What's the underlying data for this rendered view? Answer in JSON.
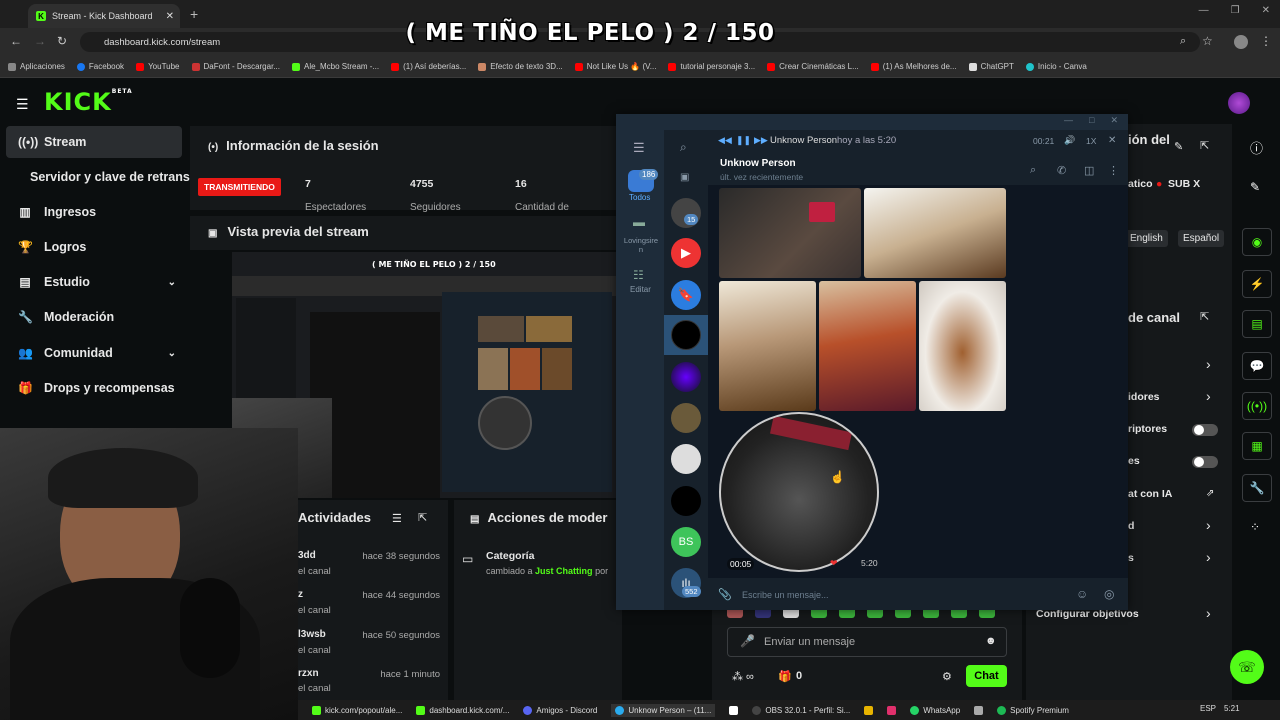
{
  "overlay_title": "( ME TIÑO EL PELO ) 2 / 150",
  "browser": {
    "tab_title": "Stream - Kick Dashboard",
    "url": "dashboard.kick.com/stream",
    "bookmarks": [
      "Aplicaciones",
      "Facebook",
      "YouTube",
      "DaFont - Descargar...",
      "Ale_Mcbo Stream -...",
      "(1) Así deberías...",
      "Efecto de texto 3D...",
      "Not Like Us 🔥 (V...",
      "tutorial personaje 3...",
      "Crear Cinemáticas L...",
      "(1) As Melhores de...",
      "ChatGPT",
      "Inicio - Canva"
    ]
  },
  "kick": {
    "logo": "KICK",
    "logo_sup": "BETA",
    "sidebar": [
      {
        "label": "Stream",
        "icon": "broadcast-icon"
      },
      {
        "label": "Servidor y clave de retransm",
        "icon": ""
      },
      {
        "label": "Ingresos",
        "icon": "chart-icon"
      },
      {
        "label": "Logros",
        "icon": "trophy-icon"
      },
      {
        "label": "Estudio",
        "icon": "studio-icon"
      },
      {
        "label": "Moderación",
        "icon": "wrench-icon"
      },
      {
        "label": "Comunidad",
        "icon": "users-icon"
      },
      {
        "label": "Drops y recompensas",
        "icon": "gift-icon"
      }
    ],
    "session": {
      "title": "Información de la sesión",
      "live_badge": "TRANSMITIENDO",
      "stats": [
        {
          "value": "7",
          "label": "Espectadores"
        },
        {
          "value": "4755",
          "label": "Seguidores"
        },
        {
          "value": "16",
          "label": "Cantidad de"
        }
      ]
    },
    "preview_title": "Vista previa del stream",
    "activities": {
      "title": "Actividades",
      "items": [
        {
          "name": "3dd",
          "sub": "el canal",
          "time": "hace 38 segundos"
        },
        {
          "name": "z",
          "sub": "el canal",
          "time": "hace 44 segundos"
        },
        {
          "name": "l3wsb",
          "sub": "el canal",
          "time": "hace 50 segundos"
        },
        {
          "name": "rzxn",
          "sub": "el canal",
          "time": "hace 1 minuto"
        }
      ]
    },
    "moderation": {
      "title": "Acciones de moder",
      "item_title": "Categoría",
      "item_prefix": "cambiado a",
      "item_highlight": "Just Chatting",
      "item_suffix": "por"
    },
    "chat": {
      "placeholder": "Enviar un mensaje",
      "count": "0",
      "button": "Chat"
    },
    "right_panel": {
      "title_top": "ión del",
      "subtitle": "atico",
      "sub_badge": "SUB X",
      "languages": [
        "English",
        "Español"
      ],
      "channel_title": "de canal",
      "rows": [
        "idores",
        "riptores",
        "es",
        "at con IA",
        "d",
        "s"
      ],
      "goals": "Configurar objetivos"
    }
  },
  "telegram": {
    "player": {
      "name": "Unknow Person",
      "when": "hoy a las 5:20",
      "time": "00:21",
      "speed": "1X"
    },
    "chat": {
      "name": "Unknow Person",
      "status": "últ. vez recientemente"
    },
    "nav": {
      "all": "Todos",
      "all_badge": "186",
      "folder": "Lovingsiren",
      "edit": "Editar"
    },
    "badges": {
      "first": "15",
      "last": "552"
    },
    "initials": "BS",
    "video_note": {
      "elapsed": "00:05",
      "timestamp": "5:20"
    },
    "input_placeholder": "Escribe un mensaje..."
  },
  "taskbar": [
    "kick.com/popout/ale...",
    "dashboard.kick.com/...",
    "Amigos - Discord",
    "Unknow Person – (11...",
    "OBS 32.0.1 - Perfil: Si...",
    "WhatsApp",
    "Spotify Premium"
  ],
  "tray": {
    "lang": "ESP",
    "time": "5:21"
  },
  "colors": {
    "kick_green": "#53fc18",
    "live_red": "#e91916",
    "telegram_bg": "#17212b"
  }
}
